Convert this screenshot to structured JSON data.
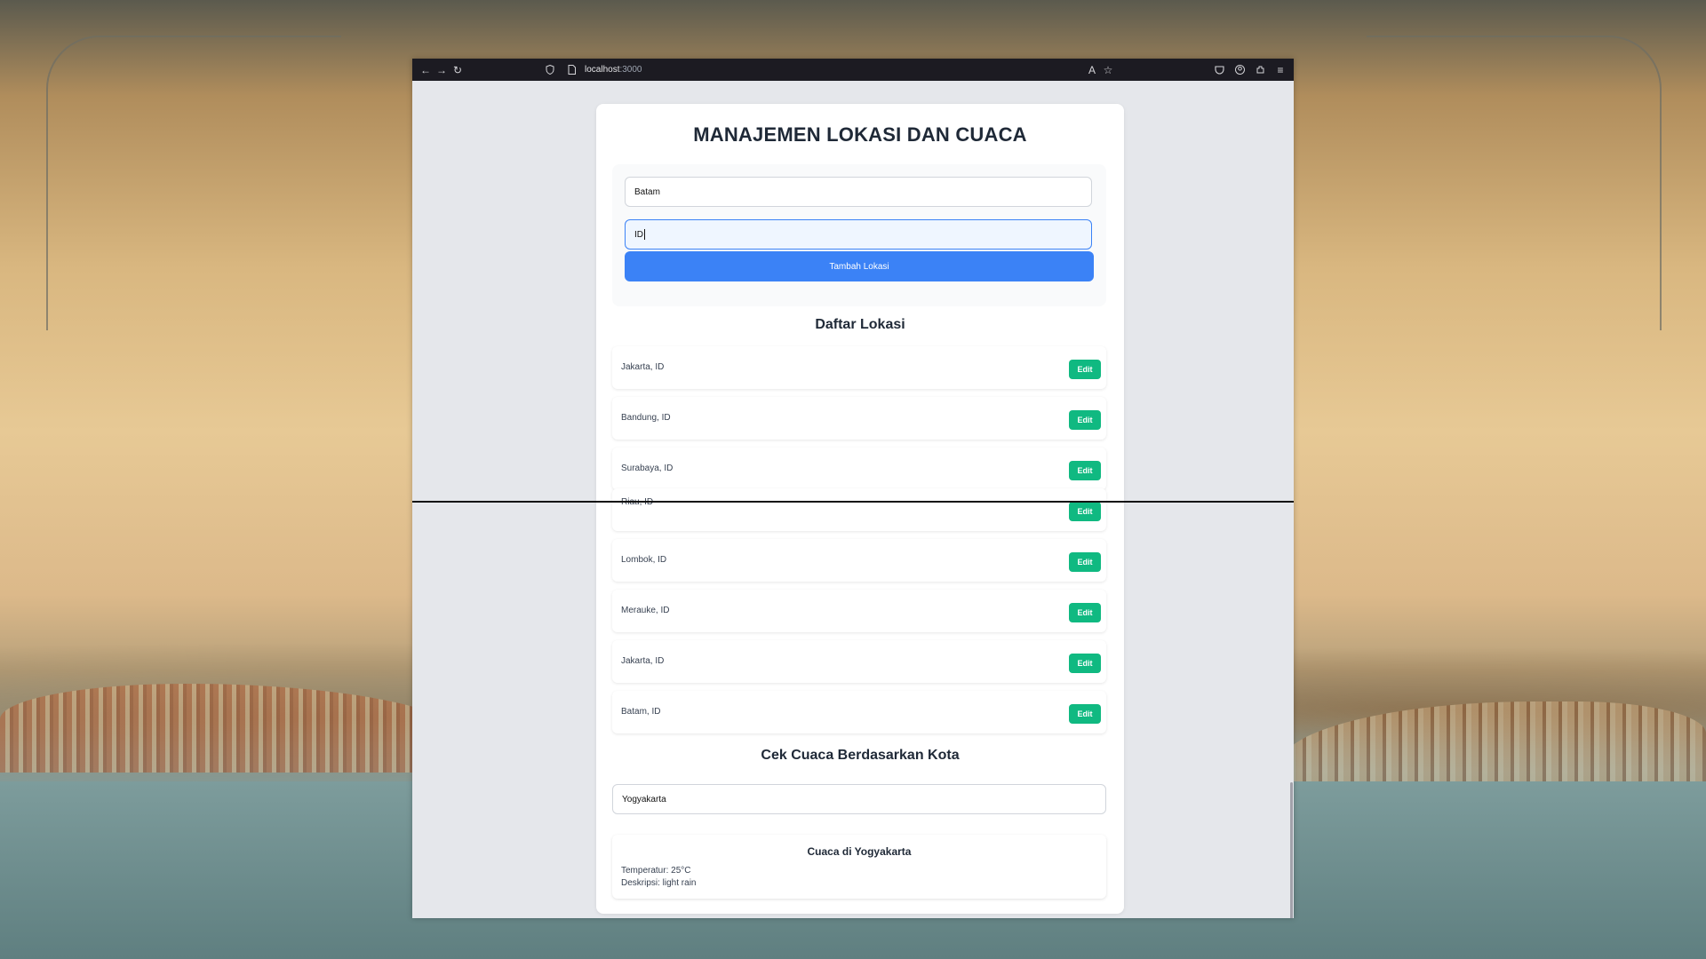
{
  "browser": {
    "url_host": "localhost",
    "url_port": ":3000"
  },
  "page": {
    "title": "MANAJEMEN LOKASI DAN CUACA",
    "form": {
      "city_value": "Batam",
      "country_value": "ID",
      "add_button": "Tambah Lokasi"
    },
    "list_title": "Daftar Lokasi",
    "edit_label": "Edit",
    "locations": [
      {
        "label": "Jakarta, ID"
      },
      {
        "label": "Bandung, ID"
      },
      {
        "label": "Surabaya, ID"
      },
      {
        "label": "Riau, ID"
      },
      {
        "label": "Lombok, ID"
      },
      {
        "label": "Merauke, ID"
      },
      {
        "label": "Jakarta, ID"
      },
      {
        "label": "Batam, ID"
      }
    ],
    "weather_title": "Cek Cuaca Berdasarkan Kota",
    "weather_input_value": "Yogyakarta",
    "weather_result": {
      "heading": "Cuaca di Yogyakarta",
      "temperature": "Temperatur: 25°C",
      "description": "Deskripsi: light rain"
    }
  },
  "colors": {
    "primary": "#3b82f6",
    "edit": "#10b981",
    "page_bg": "#e5e7eb"
  }
}
